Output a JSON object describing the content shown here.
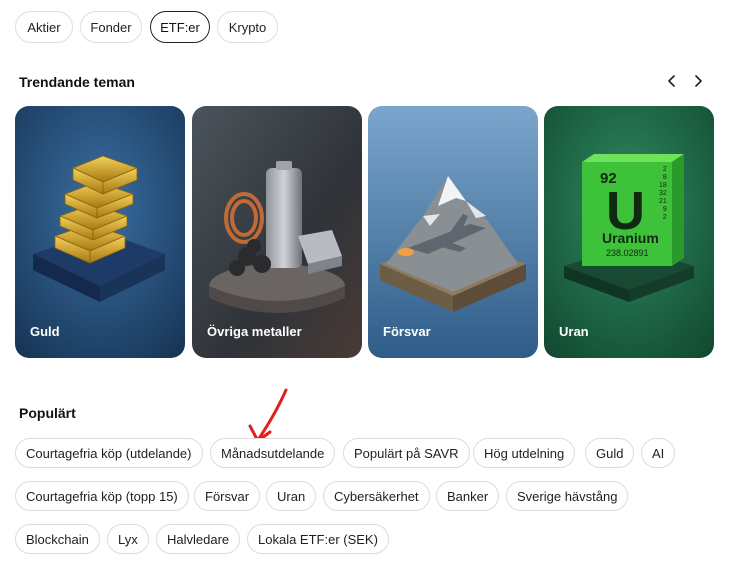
{
  "filters": {
    "items": [
      {
        "label": "Aktier"
      },
      {
        "label": "Fonder"
      },
      {
        "label": "ETF:er",
        "active": true
      },
      {
        "label": "Krypto"
      }
    ]
  },
  "themes": {
    "title": "Trendande teman",
    "prev_icon": "chevron-left-icon",
    "next_icon": "chevron-right-icon",
    "cards": [
      {
        "label": "Guld",
        "image": "gold-bars"
      },
      {
        "label": "Övriga metaller",
        "image": "battery-metals"
      },
      {
        "label": "Försvar",
        "image": "fighter-jet-mountain"
      },
      {
        "label": "Uran",
        "image": "uranium-element-block",
        "symbol": "U",
        "number": "92",
        "name": "Uranium",
        "mass": "238.02891",
        "shells": [
          "2",
          "8",
          "18",
          "32",
          "21",
          "9",
          "2"
        ]
      }
    ]
  },
  "popular": {
    "title": "Populärt",
    "tags": [
      "Courtagefria köp (utdelande)",
      "Månadsutdelande",
      "Populärt på SAVR",
      "Hög utdelning",
      "Guld",
      "AI",
      "Courtagefria köp (topp 15)",
      "Försvar",
      "Uran",
      "Cybersäkerhet",
      "Banker",
      "Sverige hävstång",
      "Blockchain",
      "Lyx",
      "Halvledare",
      "Lokala ETF:er (SEK)"
    ]
  },
  "colors": {
    "annotation_arrow": "#e0201a",
    "card_gold_bg": "#2a5584",
    "card_metals_bg": "#3a3f47",
    "card_defense_bg": "#4f7da8",
    "card_uranium_bg": "#1f6a47"
  }
}
